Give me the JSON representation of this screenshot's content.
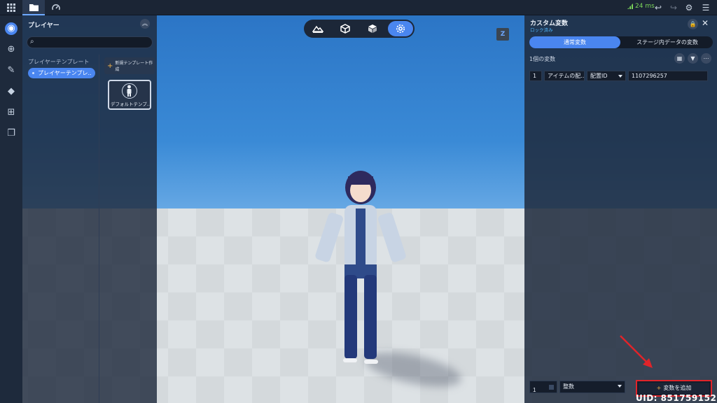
{
  "topbar": {
    "ping_text": "24 ms"
  },
  "left_panel": {
    "title": "プレイヤー",
    "search_placeholder": "",
    "template_heading": "プレイヤーテンプレート",
    "template_chip": "プレイヤーテンプレ..",
    "new_template_label": "新規テンプレート作成",
    "default_card_label": "デフォルトテンプ..."
  },
  "right_panel": {
    "title": "カスタム変数",
    "subtitle": "ロック済み",
    "tabs": [
      "通常変数",
      "ステージ内データの変数"
    ],
    "count_text": "1個の変数",
    "rows": [
      {
        "index": "1",
        "name": "アイテムの配...",
        "type": "配置ID",
        "value": "1107296257"
      }
    ],
    "add_index": "1",
    "add_type": "整数",
    "add_button": "変数を追加"
  },
  "overlay": {
    "z_badge": "Z",
    "uid": "UID: 851759152"
  },
  "colors": {
    "accent": "#4a86f0",
    "panel": "#1e2a3c",
    "highlight_border": "#e0242a",
    "subtitle": "#50b8ff"
  }
}
